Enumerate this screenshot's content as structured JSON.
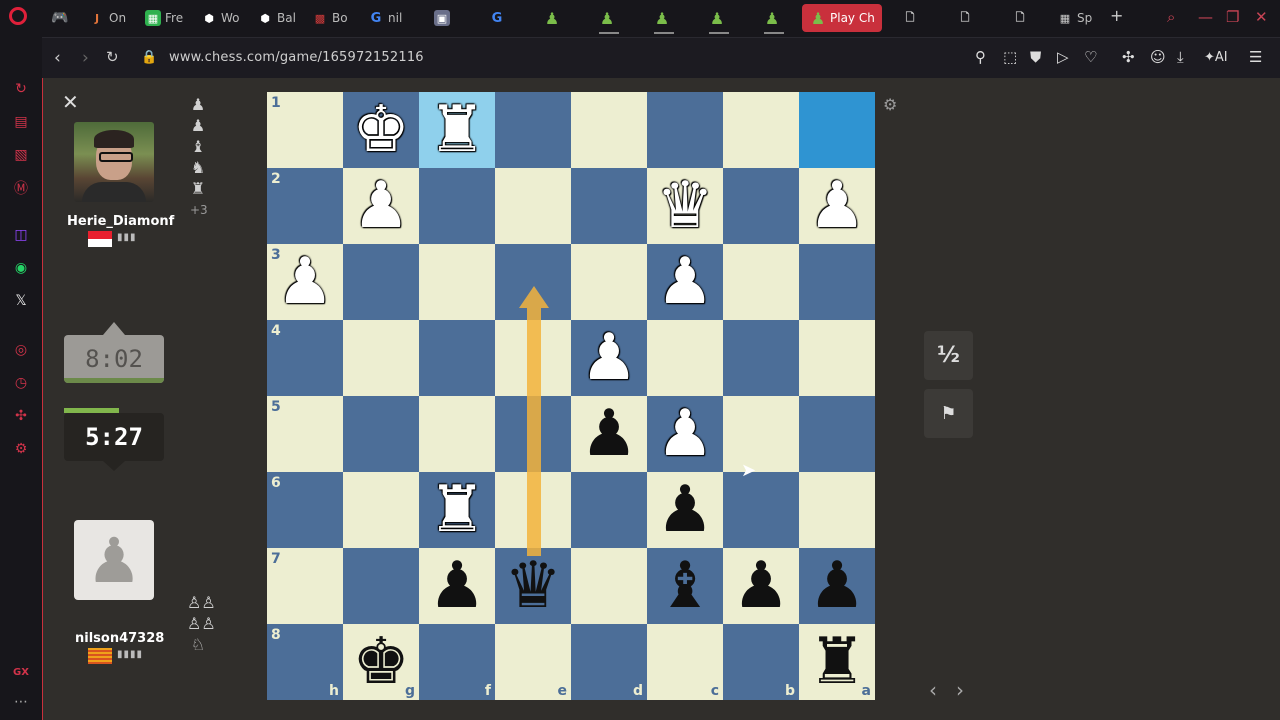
{
  "browser": {
    "tabs": [
      {
        "label": "On",
        "icon": "j-icon",
        "color": "#e2743a"
      },
      {
        "label": "Fre",
        "icon": "f-icon",
        "color": "#2fb14f"
      },
      {
        "label": "Wo",
        "icon": "hex-icon",
        "color": "#ffffff"
      },
      {
        "label": "Bal",
        "icon": "hex-icon",
        "color": "#ffffff"
      },
      {
        "label": "Bo",
        "icon": "checker-icon",
        "color": "#d23b3b"
      },
      {
        "label": "nil",
        "icon": "google-icon",
        "color": "#4285f4"
      }
    ],
    "active_tab": "Play Ch",
    "extra_tab": "Sp",
    "url": "www.chess.com/game/165972152116"
  },
  "toolbar": {
    "ai_label": "AI"
  },
  "top_player": {
    "name": "Herie_Diamonf",
    "clock": "8:02",
    "flag": "indonesia",
    "captured": [
      "♟",
      "♟",
      "♝",
      "♞",
      "♜"
    ],
    "captured_more": "+3"
  },
  "bottom_player": {
    "name": "nilson47328",
    "clock": "5:27",
    "flag": "spain",
    "captured": [
      "♙♙",
      "♙♙",
      "♘"
    ]
  },
  "board": {
    "ranks": [
      "1",
      "2",
      "3",
      "4",
      "5",
      "6",
      "7",
      "8"
    ],
    "files": [
      "h",
      "g",
      "f",
      "e",
      "d",
      "c",
      "b",
      "a"
    ],
    "rows": [
      [
        "",
        "wK",
        "wR",
        "",
        "",
        "",
        "",
        ""
      ],
      [
        "",
        "wP",
        "",
        "",
        "",
        "wQ",
        "",
        "wP"
      ],
      [
        "wP",
        "",
        "",
        "",
        "",
        "wP",
        "",
        ""
      ],
      [
        "",
        "",
        "",
        "",
        "wP",
        "",
        "",
        ""
      ],
      [
        "",
        "",
        "",
        "",
        "bP",
        "wP",
        "",
        ""
      ],
      [
        "",
        "",
        "wR",
        "",
        "",
        "bP",
        "",
        ""
      ],
      [
        "",
        "",
        "bP",
        "bQ",
        "",
        "bB",
        "bP",
        "bP"
      ],
      [
        "",
        "bK",
        "",
        "",
        "",
        "",
        "",
        "bR"
      ]
    ],
    "highlight": [
      [
        0,
        2
      ],
      [
        0,
        7
      ]
    ],
    "arrow": "e7-e3",
    "colors": {
      "light": "#edeed1",
      "dark": "#4c6e98",
      "arrow": "#f2b33c"
    }
  },
  "controls": {
    "draw_label": "½",
    "resign_icon": "flag-icon"
  }
}
